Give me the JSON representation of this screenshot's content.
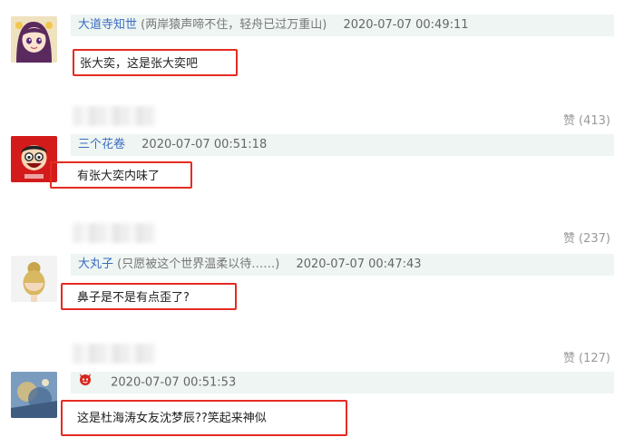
{
  "colors": {
    "highlight_border": "#e52b22",
    "username": "#3a6cc1",
    "meta_bg": "#eef5f2"
  },
  "comments": [
    {
      "username": "大道寺知世",
      "signature": "(两岸猿声啼不住，轻舟已过万重山)",
      "timestamp": "2020-07-07 00:49:11",
      "text": "张大奕，这是张大奕吧",
      "like_label": "赞",
      "like_count": "(413)"
    },
    {
      "username": "三个花卷",
      "signature": "",
      "timestamp": "2020-07-07 00:51:18",
      "text": "有张大奕内味了",
      "like_label": "赞",
      "like_count": "(237)"
    },
    {
      "username": "大丸子",
      "signature": "(只愿被这个世界温柔以待……)",
      "timestamp": "2020-07-07 00:47:43",
      "text": "鼻子是不是有点歪了?",
      "like_label": "赞",
      "like_count": "(127)"
    },
    {
      "username": "",
      "signature": "",
      "timestamp": "2020-07-07 00:51:53",
      "text": "这是杜海涛女友沈梦辰??笑起来神似",
      "avatar_icon": "devil-icon"
    }
  ]
}
